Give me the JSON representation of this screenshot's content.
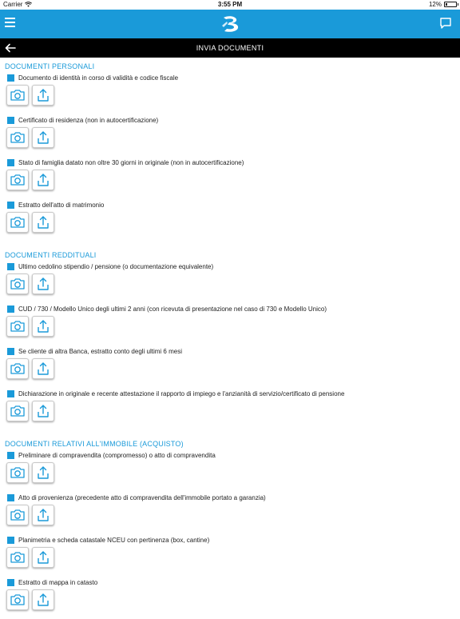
{
  "status_bar": {
    "carrier": "Carrier",
    "time": "3:55 PM",
    "battery": "12%"
  },
  "app_bar": {
    "menu_icon": "hamburger-icon",
    "logo_icon": "bank-logo",
    "chat_icon": "chat-bubble-icon"
  },
  "title_bar": {
    "title": "INVIA DOCUMENTI",
    "back_icon": "arrow-left-icon"
  },
  "colors": {
    "accent": "#1a9ad9",
    "title_bar_bg": "#000000"
  },
  "sections": [
    {
      "title": "DOCUMENTI PERSONALI",
      "items": [
        "Documento di identità in corso di validità e codice fiscale",
        "Certificato di residenza (non in autocertificazione)",
        "Stato di famiglia datato non oltre 30 giorni in originale (non in autocertificazione)",
        "Estratto dell'atto di matrimonio"
      ]
    },
    {
      "title": "DOCUMENTI REDDITUALI",
      "items": [
        "Ultimo cedolino stipendio / pensione (o documentazione equivalente)",
        "CUD / 730 / Modello Unico degli ultimi 2 anni (con ricevuta di presentazione nel caso di 730 e Modello  Unico)",
        "Se cliente di altra Banca, estratto conto degli ultimi 6 mesi",
        "Dichiarazione in originale e recente attestazione il rapporto di impiego e l'anzianità di servizio/certificato  di pensione"
      ]
    },
    {
      "title": "DOCUMENTI RELATIVI ALL'IMMOBILE (ACQUISTO)",
      "items": [
        "Preliminare di compravendita (compromesso) o atto di compravendita",
        "Atto di provenienza (precedente atto di compravendita dell'immobile portato a garanzia)",
        "Planimetria e scheda catastale NCEU con pertinenza (box, cantine)",
        "Estratto di mappa in catasto"
      ]
    }
  ]
}
